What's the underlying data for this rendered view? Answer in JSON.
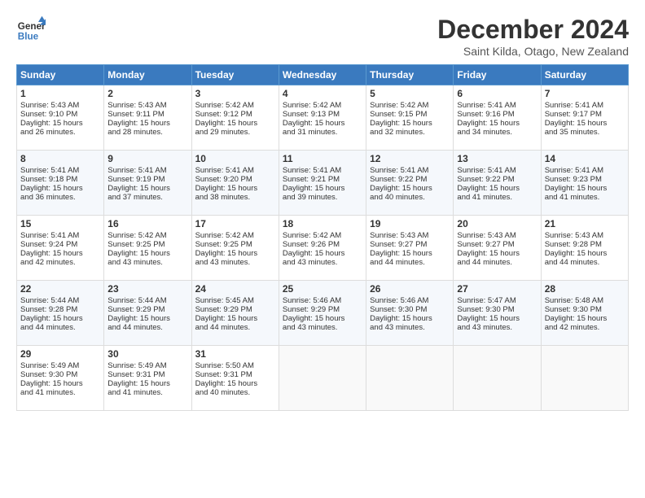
{
  "header": {
    "logo_line1": "General",
    "logo_line2": "Blue",
    "month_title": "December 2024",
    "location": "Saint Kilda, Otago, New Zealand"
  },
  "weekdays": [
    "Sunday",
    "Monday",
    "Tuesday",
    "Wednesday",
    "Thursday",
    "Friday",
    "Saturday"
  ],
  "weeks": [
    [
      {
        "day": "1",
        "lines": [
          "Sunrise: 5:43 AM",
          "Sunset: 9:10 PM",
          "Daylight: 15 hours",
          "and 26 minutes."
        ]
      },
      {
        "day": "2",
        "lines": [
          "Sunrise: 5:43 AM",
          "Sunset: 9:11 PM",
          "Daylight: 15 hours",
          "and 28 minutes."
        ]
      },
      {
        "day": "3",
        "lines": [
          "Sunrise: 5:42 AM",
          "Sunset: 9:12 PM",
          "Daylight: 15 hours",
          "and 29 minutes."
        ]
      },
      {
        "day": "4",
        "lines": [
          "Sunrise: 5:42 AM",
          "Sunset: 9:13 PM",
          "Daylight: 15 hours",
          "and 31 minutes."
        ]
      },
      {
        "day": "5",
        "lines": [
          "Sunrise: 5:42 AM",
          "Sunset: 9:15 PM",
          "Daylight: 15 hours",
          "and 32 minutes."
        ]
      },
      {
        "day": "6",
        "lines": [
          "Sunrise: 5:41 AM",
          "Sunset: 9:16 PM",
          "Daylight: 15 hours",
          "and 34 minutes."
        ]
      },
      {
        "day": "7",
        "lines": [
          "Sunrise: 5:41 AM",
          "Sunset: 9:17 PM",
          "Daylight: 15 hours",
          "and 35 minutes."
        ]
      }
    ],
    [
      {
        "day": "8",
        "lines": [
          "Sunrise: 5:41 AM",
          "Sunset: 9:18 PM",
          "Daylight: 15 hours",
          "and 36 minutes."
        ]
      },
      {
        "day": "9",
        "lines": [
          "Sunrise: 5:41 AM",
          "Sunset: 9:19 PM",
          "Daylight: 15 hours",
          "and 37 minutes."
        ]
      },
      {
        "day": "10",
        "lines": [
          "Sunrise: 5:41 AM",
          "Sunset: 9:20 PM",
          "Daylight: 15 hours",
          "and 38 minutes."
        ]
      },
      {
        "day": "11",
        "lines": [
          "Sunrise: 5:41 AM",
          "Sunset: 9:21 PM",
          "Daylight: 15 hours",
          "and 39 minutes."
        ]
      },
      {
        "day": "12",
        "lines": [
          "Sunrise: 5:41 AM",
          "Sunset: 9:22 PM",
          "Daylight: 15 hours",
          "and 40 minutes."
        ]
      },
      {
        "day": "13",
        "lines": [
          "Sunrise: 5:41 AM",
          "Sunset: 9:22 PM",
          "Daylight: 15 hours",
          "and 41 minutes."
        ]
      },
      {
        "day": "14",
        "lines": [
          "Sunrise: 5:41 AM",
          "Sunset: 9:23 PM",
          "Daylight: 15 hours",
          "and 41 minutes."
        ]
      }
    ],
    [
      {
        "day": "15",
        "lines": [
          "Sunrise: 5:41 AM",
          "Sunset: 9:24 PM",
          "Daylight: 15 hours",
          "and 42 minutes."
        ]
      },
      {
        "day": "16",
        "lines": [
          "Sunrise: 5:42 AM",
          "Sunset: 9:25 PM",
          "Daylight: 15 hours",
          "and 43 minutes."
        ]
      },
      {
        "day": "17",
        "lines": [
          "Sunrise: 5:42 AM",
          "Sunset: 9:25 PM",
          "Daylight: 15 hours",
          "and 43 minutes."
        ]
      },
      {
        "day": "18",
        "lines": [
          "Sunrise: 5:42 AM",
          "Sunset: 9:26 PM",
          "Daylight: 15 hours",
          "and 43 minutes."
        ]
      },
      {
        "day": "19",
        "lines": [
          "Sunrise: 5:43 AM",
          "Sunset: 9:27 PM",
          "Daylight: 15 hours",
          "and 44 minutes."
        ]
      },
      {
        "day": "20",
        "lines": [
          "Sunrise: 5:43 AM",
          "Sunset: 9:27 PM",
          "Daylight: 15 hours",
          "and 44 minutes."
        ]
      },
      {
        "day": "21",
        "lines": [
          "Sunrise: 5:43 AM",
          "Sunset: 9:28 PM",
          "Daylight: 15 hours",
          "and 44 minutes."
        ]
      }
    ],
    [
      {
        "day": "22",
        "lines": [
          "Sunrise: 5:44 AM",
          "Sunset: 9:28 PM",
          "Daylight: 15 hours",
          "and 44 minutes."
        ]
      },
      {
        "day": "23",
        "lines": [
          "Sunrise: 5:44 AM",
          "Sunset: 9:29 PM",
          "Daylight: 15 hours",
          "and 44 minutes."
        ]
      },
      {
        "day": "24",
        "lines": [
          "Sunrise: 5:45 AM",
          "Sunset: 9:29 PM",
          "Daylight: 15 hours",
          "and 44 minutes."
        ]
      },
      {
        "day": "25",
        "lines": [
          "Sunrise: 5:46 AM",
          "Sunset: 9:29 PM",
          "Daylight: 15 hours",
          "and 43 minutes."
        ]
      },
      {
        "day": "26",
        "lines": [
          "Sunrise: 5:46 AM",
          "Sunset: 9:30 PM",
          "Daylight: 15 hours",
          "and 43 minutes."
        ]
      },
      {
        "day": "27",
        "lines": [
          "Sunrise: 5:47 AM",
          "Sunset: 9:30 PM",
          "Daylight: 15 hours",
          "and 43 minutes."
        ]
      },
      {
        "day": "28",
        "lines": [
          "Sunrise: 5:48 AM",
          "Sunset: 9:30 PM",
          "Daylight: 15 hours",
          "and 42 minutes."
        ]
      }
    ],
    [
      {
        "day": "29",
        "lines": [
          "Sunrise: 5:49 AM",
          "Sunset: 9:30 PM",
          "Daylight: 15 hours",
          "and 41 minutes."
        ]
      },
      {
        "day": "30",
        "lines": [
          "Sunrise: 5:49 AM",
          "Sunset: 9:31 PM",
          "Daylight: 15 hours",
          "and 41 minutes."
        ]
      },
      {
        "day": "31",
        "lines": [
          "Sunrise: 5:50 AM",
          "Sunset: 9:31 PM",
          "Daylight: 15 hours",
          "and 40 minutes."
        ]
      },
      {
        "day": "",
        "lines": []
      },
      {
        "day": "",
        "lines": []
      },
      {
        "day": "",
        "lines": []
      },
      {
        "day": "",
        "lines": []
      }
    ]
  ]
}
